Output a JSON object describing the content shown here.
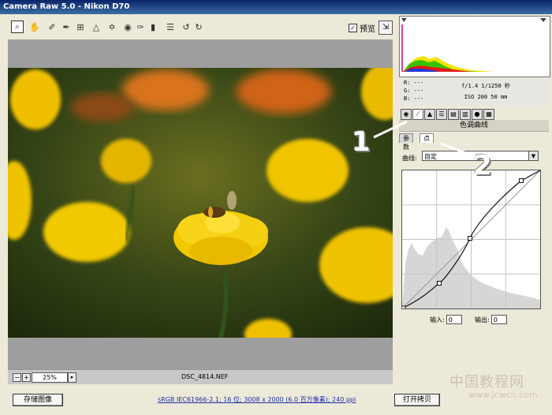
{
  "window": {
    "title": "Camera Raw 5.0 - Nikon D70"
  },
  "toolbar": {
    "tools": [
      {
        "name": "zoom-tool",
        "glyph": "⌕",
        "selected": true
      },
      {
        "name": "hand-tool",
        "glyph": "✋"
      },
      {
        "name": "white-balance-tool",
        "glyph": "✐"
      },
      {
        "name": "color-sampler-tool",
        "glyph": "✒"
      },
      {
        "name": "crop-tool",
        "glyph": "⊞"
      },
      {
        "name": "straighten-tool",
        "glyph": "△"
      },
      {
        "name": "retouch-tool",
        "glyph": "✡"
      },
      {
        "name": "red-eye-tool",
        "glyph": "◉"
      },
      {
        "name": "adjustment-brush-tool",
        "glyph": "✑"
      },
      {
        "name": "graduated-filter-tool",
        "glyph": "▮"
      },
      {
        "name": "preferences-tool",
        "glyph": "☰"
      },
      {
        "name": "rotate-left-tool",
        "glyph": "↺"
      },
      {
        "name": "rotate-right-tool",
        "glyph": "↻"
      }
    ],
    "preview_label": "预览",
    "preview_checked": "✓"
  },
  "canvas": {
    "zoom": "25%",
    "filename": "DSC_4814.NEF"
  },
  "histogram": {
    "r": "R: ---",
    "g": "G: ---",
    "b": "B: ---",
    "exposure": "f/1.4  1/1250 秒",
    "iso": "ISO 200  50 mm"
  },
  "panel": {
    "title": "色调曲线",
    "subtab_params": "参数",
    "subtab_point": "点",
    "curve_label": "曲线:",
    "curve_value": "自定",
    "input_label": "输入:",
    "input_value": "0",
    "output_label": "输出:",
    "output_value": "0"
  },
  "footer": {
    "save_label": "存储图像",
    "workflow_text": "sRGB IEC61966-2.1; 16 位; 3008 x 2000 (6.0 百万像素); 240 ppi",
    "open_label": "打开拷贝"
  },
  "annotations": {
    "callout_1": "1",
    "callout_2": "2"
  },
  "watermark": {
    "text": "中国教程网",
    "url": "www.jcwcn.com"
  },
  "colors": {
    "title_bar": "#0a246a",
    "canvas_gray": "#9e9e9e",
    "flower_yellow": "#f2c900"
  }
}
